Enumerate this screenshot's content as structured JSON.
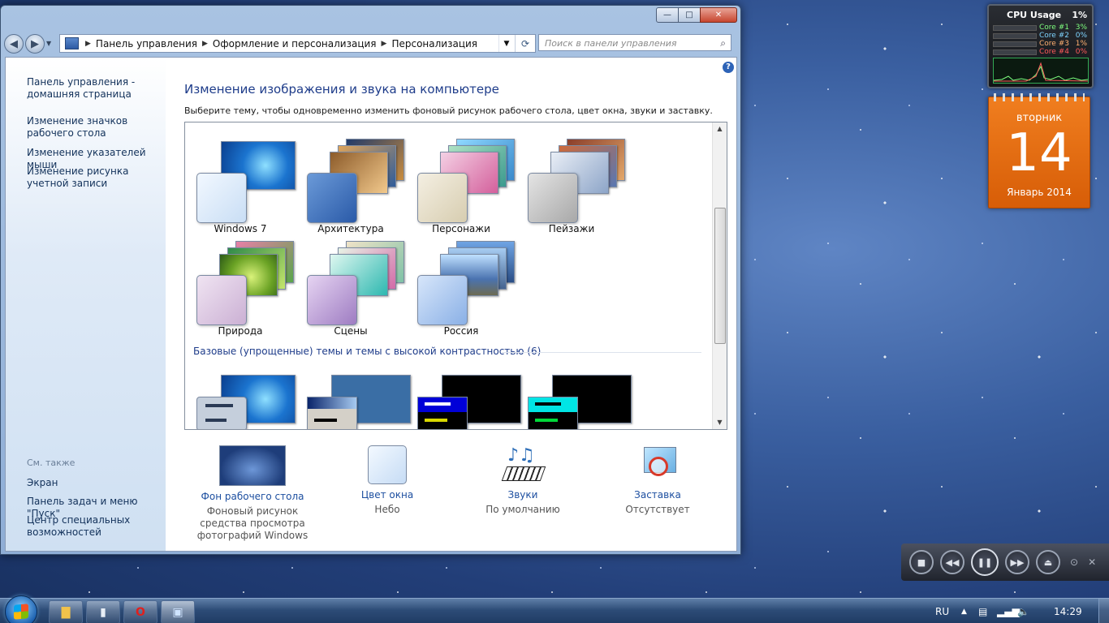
{
  "window": {
    "caption_buttons": {
      "minimize": "—",
      "maximize": "□",
      "close": "✕"
    },
    "breadcrumb": [
      "Панель управления",
      "Оформление и персонализация",
      "Персонализация"
    ],
    "search_placeholder": "Поиск в панели управления"
  },
  "sidebar": {
    "links": [
      {
        "label": "Панель управления - домашняя страница"
      },
      {
        "label": "Изменение значков рабочего стола"
      },
      {
        "label": "Изменение указателей мыши"
      },
      {
        "label": "Изменение рисунка учетной записи"
      }
    ],
    "see_also_title": "См. также",
    "see_also": [
      {
        "label": "Экран"
      },
      {
        "label": "Панель задач и меню \"Пуск\""
      },
      {
        "label": "Центр специальных возможностей"
      }
    ]
  },
  "main": {
    "title": "Изменение изображения и звука на компьютере",
    "description": "Выберите тему, чтобы одновременно изменить фоновый рисунок рабочего стола, цвет окна, звуки и заставку.",
    "themes": [
      {
        "label": "Windows 7"
      },
      {
        "label": "Архитектура"
      },
      {
        "label": "Персонажи"
      },
      {
        "label": "Пейзажи"
      },
      {
        "label": "Природа"
      },
      {
        "label": "Сцены"
      },
      {
        "label": "Россия"
      }
    ],
    "basic_group_header": "Базовые (упрощенные) темы и темы с высокой контрастностью (6)",
    "bottom": [
      {
        "link": "Фон рабочего стола",
        "sub": "Фоновый рисунок средства просмотра фотографий Windows",
        "icon": "wallpaper-icon"
      },
      {
        "link": "Цвет окна",
        "sub": "Небо",
        "icon": "window-color-icon"
      },
      {
        "link": "Звуки",
        "sub": "По умолчанию",
        "icon": "sounds-icon"
      },
      {
        "link": "Заставка",
        "sub": "Отсутствует",
        "icon": "screensaver-icon"
      }
    ]
  },
  "gadgets": {
    "cpu": {
      "title": "CPU Usage",
      "total": "1%",
      "cores": [
        {
          "name": "Core #1",
          "value": "3%",
          "color": "#7fff7f"
        },
        {
          "name": "Core #2",
          "value": "0%",
          "color": "#7fd4ff"
        },
        {
          "name": "Core #3",
          "value": "1%",
          "color": "#ffb070"
        },
        {
          "name": "Core #4",
          "value": "0%",
          "color": "#ff5a5a"
        }
      ]
    },
    "calendar": {
      "weekday": "вторник",
      "day": "14",
      "month_year": "Январь 2014"
    }
  },
  "taskbar": {
    "lang": "RU",
    "time": "14:29"
  },
  "colors": {
    "accent_link": "#1d4fa0",
    "heading": "#1e3c8a"
  }
}
